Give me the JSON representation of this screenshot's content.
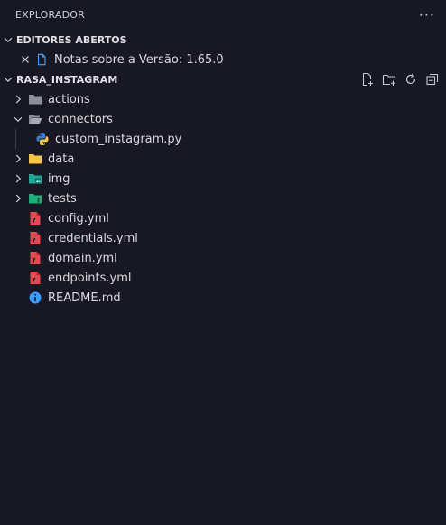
{
  "header": {
    "title": "EXPLORADOR",
    "more": "···"
  },
  "open_editors": {
    "title": "EDITORES ABERTOS",
    "items": [
      {
        "label": "Notas sobre a Versão: 1.65.0"
      }
    ]
  },
  "project": {
    "title": "RASA_INSTAGRAM",
    "tree": [
      {
        "label": "actions",
        "kind": "folder"
      },
      {
        "label": "connectors",
        "kind": "folder-open"
      },
      {
        "label": "custom_instagram.py",
        "kind": "python"
      },
      {
        "label": "data",
        "kind": "folder-data"
      },
      {
        "label": "img",
        "kind": "folder-img"
      },
      {
        "label": "tests",
        "kind": "folder-tests"
      },
      {
        "label": "config.yml",
        "kind": "yaml"
      },
      {
        "label": "credentials.yml",
        "kind": "yaml"
      },
      {
        "label": "domain.yml",
        "kind": "yaml"
      },
      {
        "label": "endpoints.yml",
        "kind": "yaml"
      },
      {
        "label": "README.md",
        "kind": "info"
      }
    ]
  },
  "colors": {
    "background": "#181824",
    "yaml_icon": "#e5484d",
    "info_icon": "#3b9eff",
    "folder_gray": "#8a8f98",
    "folder_yellow": "#f5c542",
    "folder_teal": "#1fa89a"
  }
}
